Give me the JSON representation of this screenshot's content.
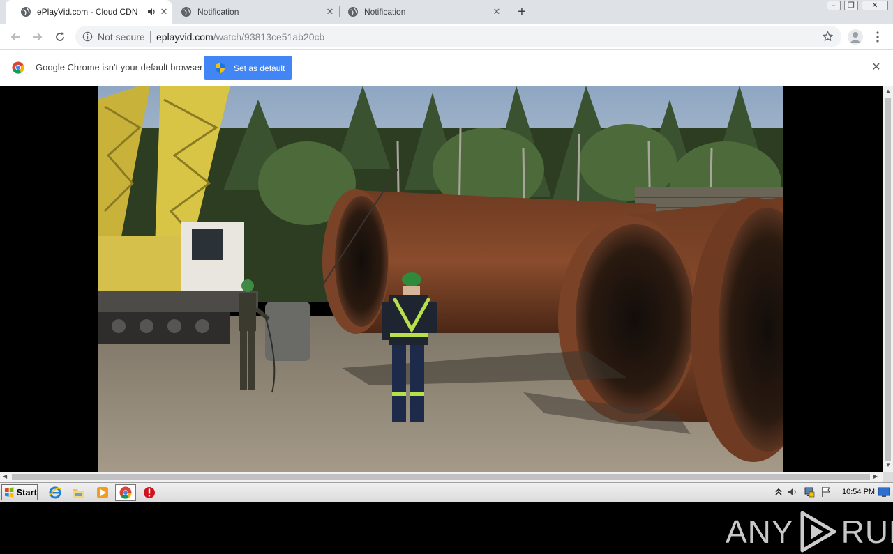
{
  "browser": {
    "tabs": [
      {
        "title": "ePlayVid.com - Cloud CDN",
        "active": true,
        "audio": true
      },
      {
        "title": "Notification",
        "active": false,
        "audio": false
      },
      {
        "title": "Notification",
        "active": false,
        "audio": false
      }
    ],
    "address": {
      "security_label": "Not secure",
      "host": "eplayvid.com",
      "path": "/watch/93813ce51ab20cb"
    }
  },
  "infobar": {
    "message": "Google Chrome isn't your default browser",
    "button_label": "Set as default"
  },
  "page": {
    "video_scene": "construction-site-large-steel-pipes-workers"
  },
  "watermark": {
    "left_text": "ANY",
    "right_text": "RUN"
  },
  "taskbar": {
    "start_label": "Start",
    "clock": "10:54 PM",
    "pinned": [
      "internet-explorer-icon",
      "file-explorer-icon",
      "media-player-icon",
      "chrome-icon",
      "stop-icon"
    ]
  },
  "colors": {
    "tabstrip": "#dee1e6",
    "accent_button": "#4285f4",
    "omnibox": "#f1f3f4"
  }
}
